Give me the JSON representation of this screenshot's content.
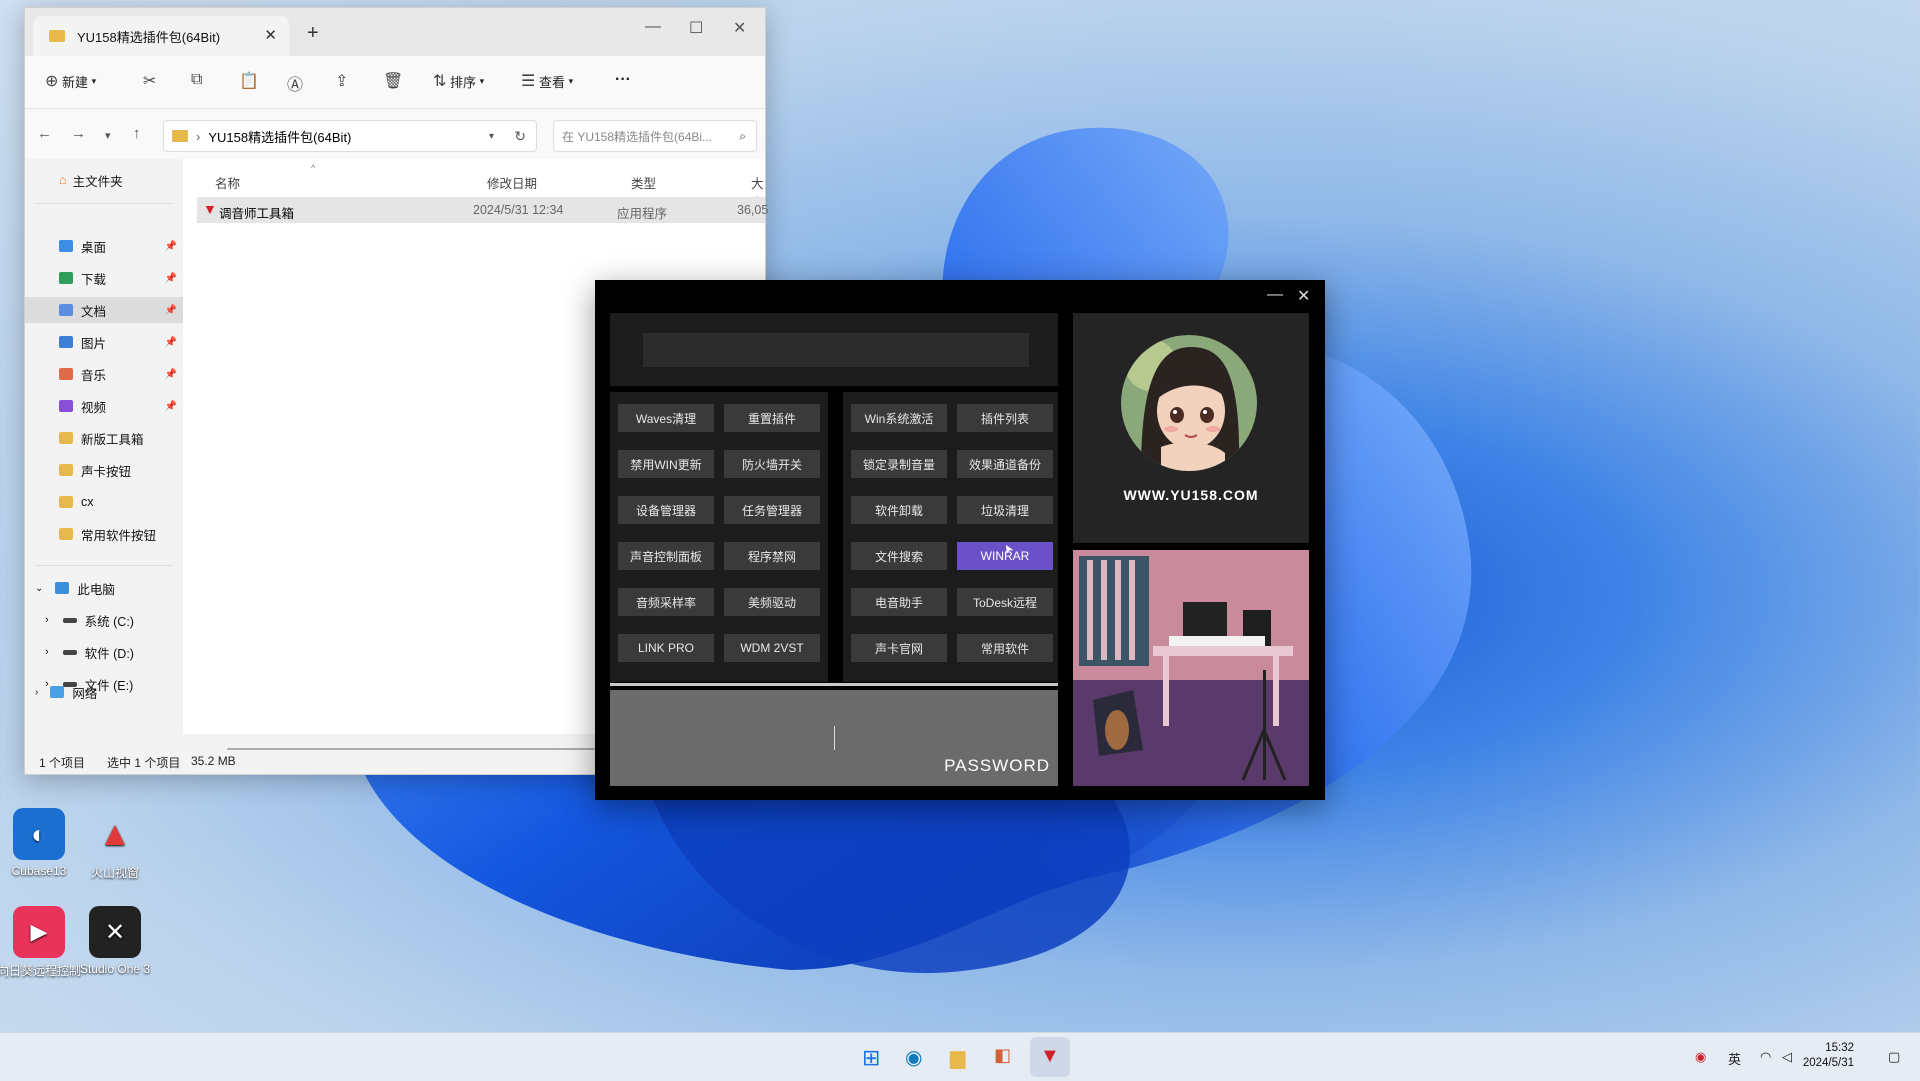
{
  "desktop": {
    "icons": [
      {
        "label": "Cubase13"
      },
      {
        "label": "火山视窗"
      },
      {
        "label": "向日葵远程控制"
      },
      {
        "label": "Studio One 3"
      }
    ]
  },
  "explorer": {
    "tab_title": "YU158精选插件包(64Bit)",
    "toolbar": {
      "new": "新建",
      "sort": "排序",
      "view": "查看",
      "more": "···"
    },
    "address": "YU158精选插件包(64Bit)",
    "search_placeholder": "在 YU158精选插件包(64Bi...",
    "nav": {
      "home": "主文件夹",
      "quick": [
        {
          "label": "桌面",
          "color": "#3a8ee6"
        },
        {
          "label": "下载",
          "color": "#2f9e5b"
        },
        {
          "label": "文档",
          "color": "#5b8ee0"
        },
        {
          "label": "图片",
          "color": "#3d7fd6"
        },
        {
          "label": "音乐",
          "color": "#e06a4a"
        },
        {
          "label": "视频",
          "color": "#8a4fd8"
        },
        {
          "label": "新版工具箱",
          "color": "#e8b84a"
        },
        {
          "label": "声卡按钮",
          "color": "#e8b84a"
        },
        {
          "label": "cx",
          "color": "#e8b84a"
        },
        {
          "label": "常用软件按钮",
          "color": "#e8b84a"
        }
      ],
      "this_pc": "此电脑",
      "drives": [
        {
          "label": "系统 (C:)"
        },
        {
          "label": "软件 (D:)"
        },
        {
          "label": "文件 (E:)"
        }
      ],
      "network": "网络"
    },
    "columns": {
      "name": "名称",
      "modified": "修改日期",
      "type": "类型",
      "size": "大小"
    },
    "files": [
      {
        "name": "调音师工具箱",
        "modified": "2024/5/31 12:34",
        "type": "应用程序",
        "size": "36,05"
      }
    ],
    "status": {
      "count": "1 个项目",
      "selected": "选中 1 个项目",
      "size": "35.2 MB"
    }
  },
  "tool": {
    "left_buttons": [
      [
        "Waves清理",
        "重置插件"
      ],
      [
        "禁用WIN更新",
        "防火墙开关"
      ],
      [
        "设备管理器",
        "任务管理器"
      ],
      [
        "声音控制面板",
        "程序禁网"
      ],
      [
        "音频采样率",
        "美频驱动"
      ],
      [
        "LINK PRO",
        "WDM 2VST"
      ]
    ],
    "right_buttons": [
      [
        "Win系统激活",
        "插件列表"
      ],
      [
        "锁定录制音量",
        "效果通道备份"
      ],
      [
        "软件卸载",
        "垃圾清理"
      ],
      [
        "文件搜索",
        "WINRAR"
      ],
      [
        "电音助手",
        "ToDesk远程"
      ],
      [
        "声卡官网",
        "常用软件"
      ]
    ],
    "active_button": "WINRAR",
    "password_label": "PASSWORD",
    "site": "WWW.YU158.COM",
    "accent": "#6a51c8"
  },
  "taskbar": {
    "ime": "英",
    "time": "15:32",
    "date": "2024/5/31"
  }
}
